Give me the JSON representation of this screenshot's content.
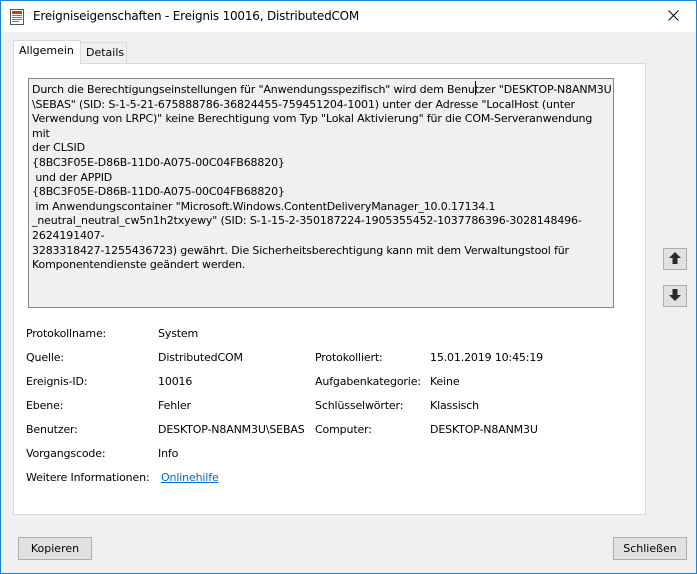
{
  "window": {
    "title": "Ereigniseigenschaften - Ereignis 10016, DistributedCOM"
  },
  "tabs": [
    {
      "label": "Allgemein"
    },
    {
      "label": "Details"
    }
  ],
  "description": "Durch die Berechtigungseinstellungen für \"Anwendungsspezifisch\" wird dem Benutzer \"DESKTOP-N8ANM3U\n\\SEBAS\" (SID: S-1-5-21-675888786-36824455-759451204-1001) unter der Adresse \"LocalHost (unter\nVerwendung von LRPC)\" keine Berechtigung vom Typ \"Lokal Aktivierung\" für die COM-Serveranwendung mit\nder CLSID\n{8BC3F05E-D86B-11D0-A075-00C04FB68820}\n und der APPID\n{8BC3F05E-D86B-11D0-A075-00C04FB68820}\n im Anwendungscontainer \"Microsoft.Windows.ContentDeliveryManager_10.0.17134.1\n_neutral_neutral_cw5n1h2txyewy\" (SID: S-1-15-2-350187224-1905355452-1037786396-3028148496-2624191407-\n3283318427-1255436723) gewährt. Die Sicherheitsberechtigung kann mit dem Verwaltungstool für\nKomponentendienste geändert werden.",
  "fields": {
    "protokollname": {
      "label": "Protokollname:",
      "value": "System"
    },
    "quelle": {
      "label": "Quelle:",
      "value": "DistributedCOM"
    },
    "protokolliert": {
      "label": "Protokolliert:",
      "value": "15.01.2019 10:45:19"
    },
    "ereignis_id": {
      "label": "Ereignis-ID:",
      "value": "10016"
    },
    "aufgabenkategorie": {
      "label": "Aufgabenkategorie:",
      "value": "Keine"
    },
    "ebene": {
      "label": "Ebene:",
      "value": "Fehler"
    },
    "schluesselwoerter": {
      "label": "Schlüsselwörter:",
      "value": "Klassisch"
    },
    "benutzer": {
      "label": "Benutzer:",
      "value": "DESKTOP-N8ANM3U\\SEBAS"
    },
    "computer": {
      "label": "Computer:",
      "value": "DESKTOP-N8ANM3U"
    },
    "vorgangscode": {
      "label": "Vorgangscode:",
      "value": "Info"
    },
    "weitere_informationen": {
      "label": "Weitere Informationen:",
      "value": "Onlinehilfe"
    }
  },
  "buttons": {
    "copy": "Kopieren",
    "close": "Schließen"
  },
  "icons": {
    "app": "event-viewer-icon",
    "close": "close-icon",
    "up": "arrow-up-icon",
    "down": "arrow-down-icon"
  },
  "colors": {
    "window_border": "#1883d7",
    "link": "#0066cc"
  }
}
